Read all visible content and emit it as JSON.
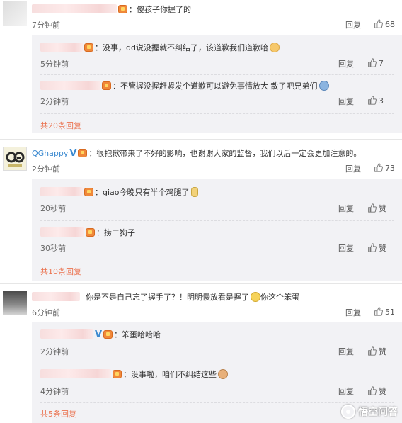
{
  "comments": [
    {
      "text": "：傻孩子你握了的",
      "time": "7分钟前",
      "reply": "回复",
      "likes": "68",
      "subs": [
        {
          "text": "：没事，dd说没握就不纠结了，该道歉我们道歉哈",
          "time": "5分钟前",
          "reply": "回复",
          "likes": "7"
        },
        {
          "text": "：不管握没握赶紧发个道歉可以避免事情放大 散了吧兄弟们",
          "time": "2分钟前",
          "reply": "回复",
          "likes": "3"
        }
      ],
      "more": "共20条回复"
    },
    {
      "user": "QGhappy",
      "text": "：很抱歉带来了不好的影响，也谢谢大家的监督，我们以后一定会更加注意的。",
      "time": "2分钟前",
      "reply": "回复",
      "likes": "73",
      "subs": [
        {
          "text": "：giao今晚只有半个鸡腿了",
          "time": "20秒前",
          "reply": "回复",
          "likes": "赞"
        },
        {
          "text": "：捞二狗子",
          "time": "30秒前",
          "reply": "回复",
          "likes": "赞"
        }
      ],
      "more": "共10条回复"
    },
    {
      "text": "你是不是自己忘了握手了？！明明慢放看是握了",
      "text_after": "你这个笨蛋",
      "time": "6分钟前",
      "reply": "回复",
      "likes": "51",
      "subs": [
        {
          "text": "：笨蛋哈哈哈",
          "time": "2分钟前",
          "reply": "回复",
          "likes": "赞"
        },
        {
          "text": "：没事啦，咱们不纠结这些",
          "time": "4分钟前",
          "reply": "回复",
          "likes": "赞"
        }
      ],
      "more": "共5条回复"
    }
  ],
  "watermark": "悟空问答",
  "colors": {
    "link": "#eb7350",
    "username_blue": "#3c8ad0",
    "sub_bg": "#f2f2f5"
  },
  "icons": [
    "thumbs-up-icon",
    "member-badge-icon",
    "verified-v-icon",
    "emoji-icon",
    "wukong-logo-icon"
  ]
}
